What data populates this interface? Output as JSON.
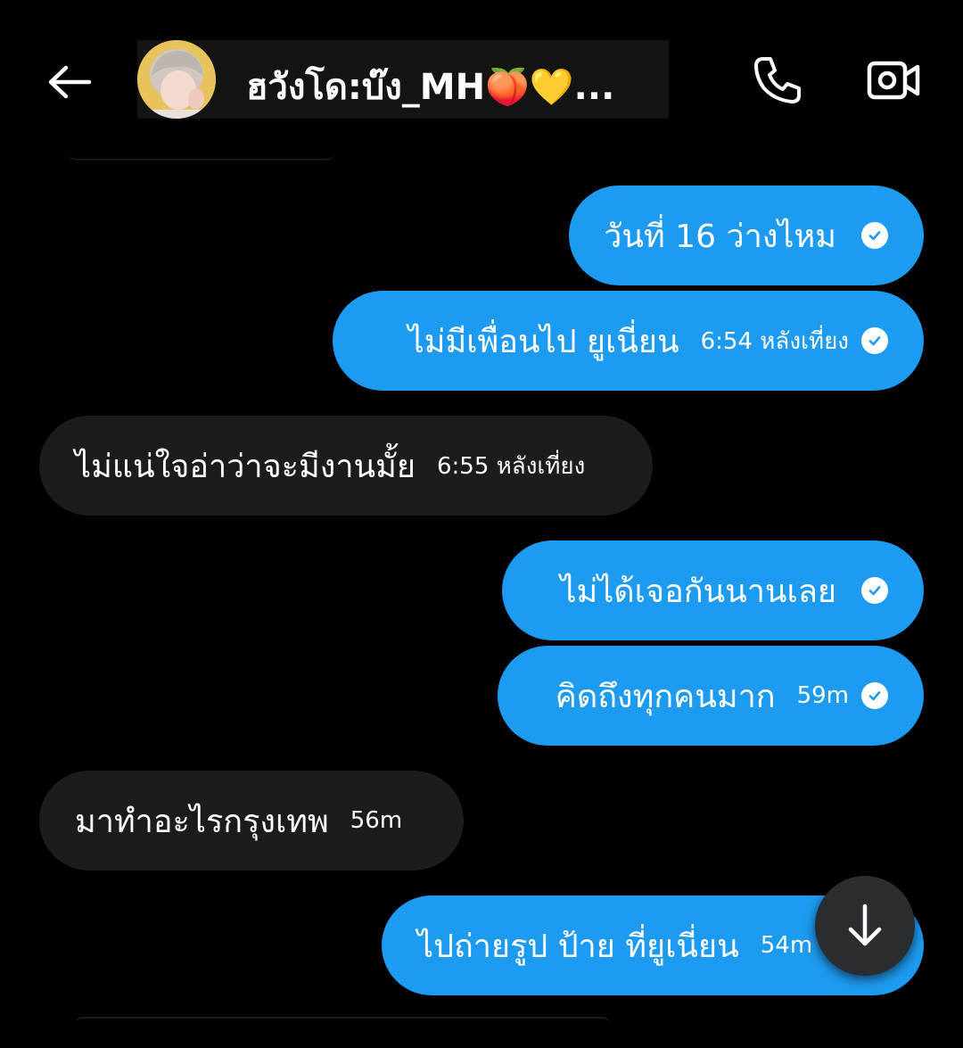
{
  "header": {
    "title": "ฮวังโด:บ๊ง_MH🍑💛...",
    "back_icon": "arrow-left-icon",
    "call_icon": "phone-icon",
    "video_icon": "video-camera-icon"
  },
  "messages": [
    {
      "type": "sent",
      "text": "วันที่ 16 ว่างไหม",
      "time": "",
      "read": true
    },
    {
      "type": "sent",
      "text": "ไม่มีเพื่อนไป ยูเนี่ยน",
      "time": "6:54 หลังเที่ยง",
      "read": true
    },
    {
      "type": "received",
      "text": "ไม่แน่ใจอ่าว่าจะมีงานมั้ย",
      "time": "6:55 หลังเที่ยง"
    },
    {
      "type": "sent",
      "text": "ไม่ได้เจอกันนานเลย",
      "time": "",
      "read": true
    },
    {
      "type": "sent",
      "text": "คิดถึงทุกคนมาก",
      "time": "59m",
      "read": true
    },
    {
      "type": "received",
      "text": "มาทำอะไรกรุงเทพ",
      "time": "56m"
    },
    {
      "type": "sent",
      "text": "ไปถ่ายรูป ป้าย ที่ยูเนี่ยน",
      "time": "54m",
      "read": false
    }
  ],
  "scroll_button_icon": "arrow-down-icon",
  "colors": {
    "sent_bubble": "#1d9bf0",
    "received_bubble": "#1c1c1e",
    "background": "#000000"
  }
}
